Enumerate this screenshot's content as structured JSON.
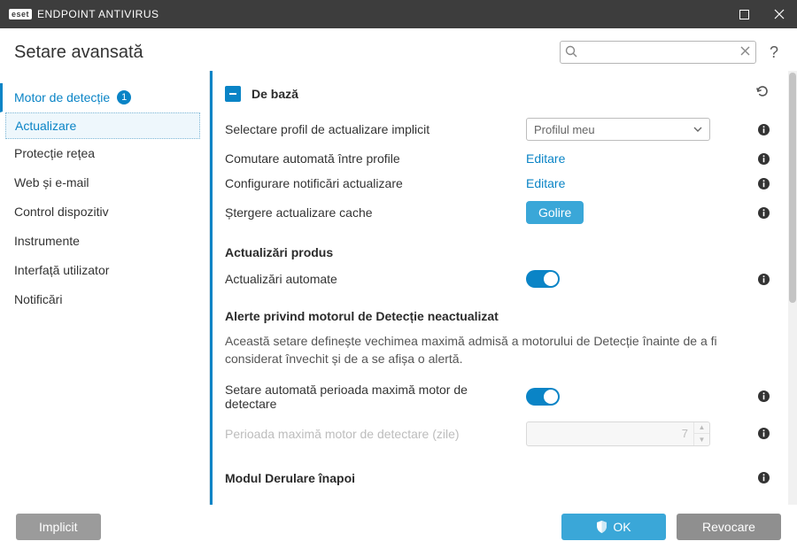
{
  "titlebar": {
    "brand_mark": "eset",
    "product": "ENDPOINT ANTIVIRUS"
  },
  "header": {
    "title": "Setare avansată",
    "search_placeholder": ""
  },
  "sidebar": {
    "items": [
      {
        "label": "Motor de detecție",
        "badge": "1"
      },
      {
        "label": "Actualizare"
      },
      {
        "label": "Protecție rețea"
      },
      {
        "label": "Web și e-mail"
      },
      {
        "label": "Control dispozitiv"
      },
      {
        "label": "Instrumente"
      },
      {
        "label": "Interfață utilizator"
      },
      {
        "label": "Notificări"
      }
    ]
  },
  "section_basic": {
    "title": "De bază",
    "profile_label": "Selectare profil de actualizare implicit",
    "profile_selected": "Profilul meu",
    "switch_profiles_label": "Comutare automată între profile",
    "switch_profiles_action": "Editare",
    "notif_label": "Configurare notificări actualizare",
    "notif_action": "Editare",
    "clear_cache_label": "Ștergere actualizare cache",
    "clear_cache_button": "Golire"
  },
  "section_product": {
    "heading": "Actualizări produs",
    "auto_label": "Actualizări automate"
  },
  "section_alerts": {
    "heading": "Alerte privind motorul de Detecție neactualizat",
    "desc": "Această setare definește vechimea maximă admisă a motorului de Detecție înainte de a fi considerat învechit și de a se afișa o alertă.",
    "auto_max_label": "Setare automată perioada maximă motor de detectare",
    "period_label": "Perioada maximă motor de detectare (zile)",
    "period_value": "7"
  },
  "section_rollback": {
    "heading": "Modul Derulare înapoi"
  },
  "footer": {
    "default": "Implicit",
    "ok": "OK",
    "cancel": "Revocare"
  }
}
